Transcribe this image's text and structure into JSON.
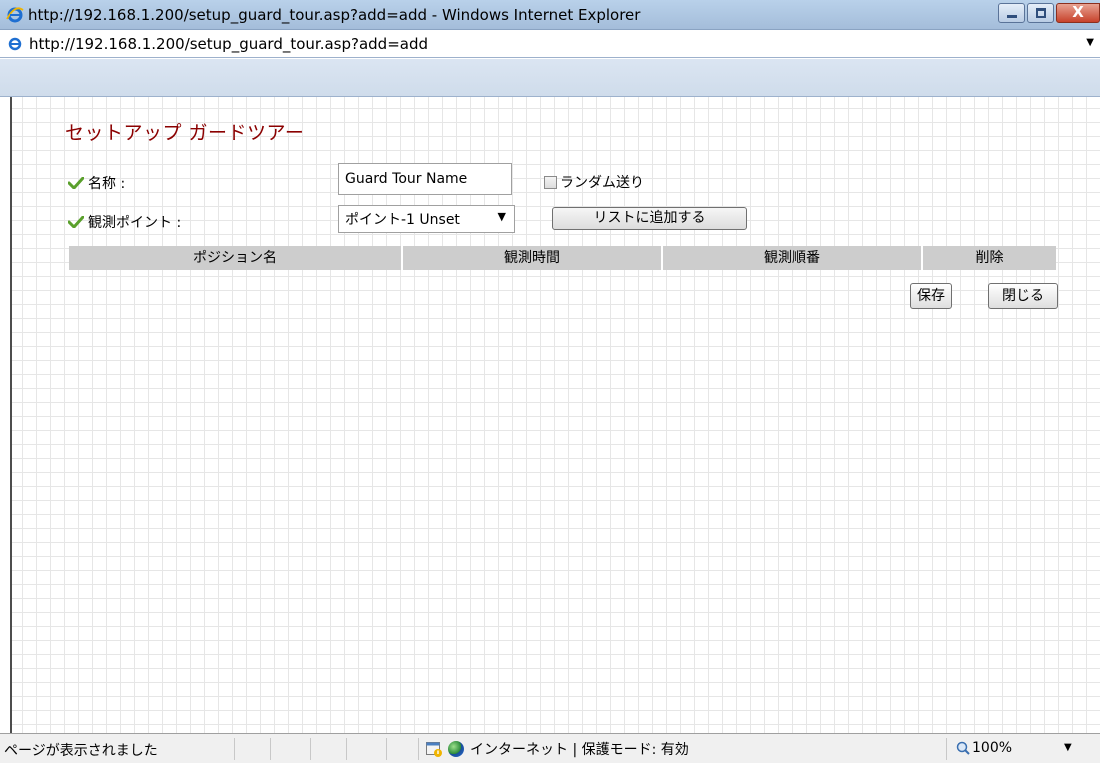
{
  "window": {
    "title": "http://192.168.1.200/setup_guard_tour.asp?add=add - Windows Internet Explorer",
    "close_glyph": "X"
  },
  "address_bar": {
    "url": "http://192.168.1.200/setup_guard_tour.asp?add=add"
  },
  "page": {
    "title": "セットアップ ガードツアー",
    "name_label": "名称 :",
    "name_value": "Guard Tour Name",
    "random_label": "ランダム送り",
    "random_checked": false,
    "point_label": "観測ポイント :",
    "point_selected": "ポイント-1  Unset",
    "add_button": "リストに追加する",
    "table_headers": [
      "ポジション名",
      "観測時間",
      "観測順番",
      "削除"
    ],
    "save_button": "保存",
    "close_button": "閉じる"
  },
  "status_bar": {
    "message": "ページが表示されました",
    "zone": "インターネット | 保護モード: 有効",
    "zoom": "100%"
  },
  "icons": {
    "check_color": "#5aa02c",
    "title_color": "#8b0000"
  }
}
